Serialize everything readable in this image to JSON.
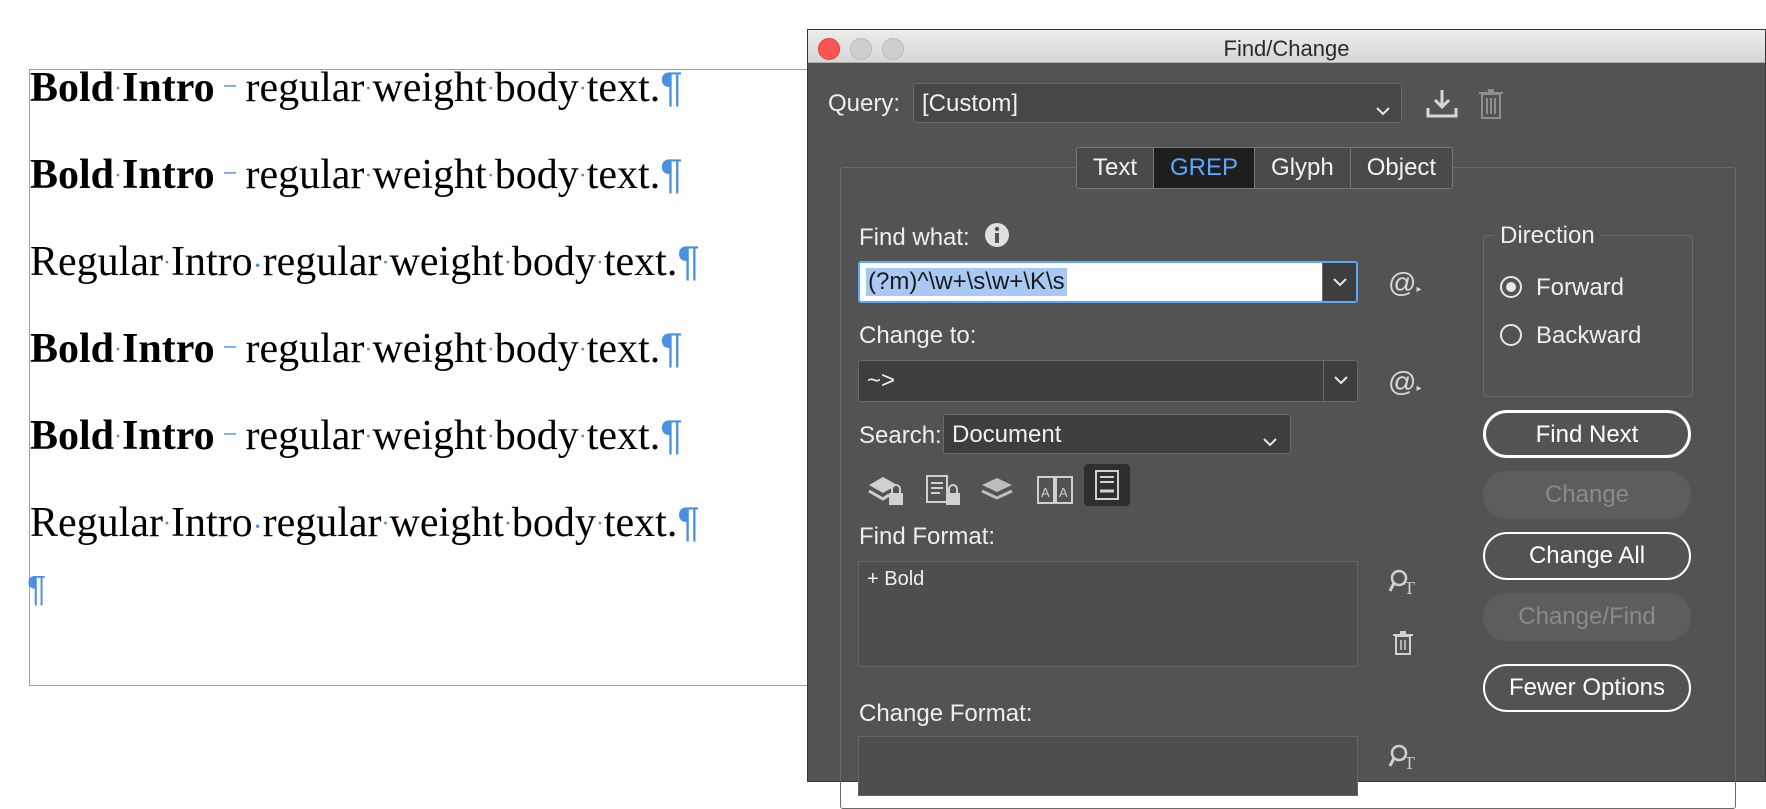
{
  "document": {
    "lines": [
      {
        "style": "bold",
        "w1": "Bold",
        "w2": "Intro",
        "rest": [
          "regular",
          "weight",
          "body",
          "text."
        ]
      },
      {
        "style": "bold",
        "w1": "Bold",
        "w2": "Intro",
        "rest": [
          "regular",
          "weight",
          "body",
          "text."
        ]
      },
      {
        "style": "regular",
        "w1": "Regular",
        "w2": "Intro",
        "rest": [
          "regular",
          "weight",
          "body",
          "text."
        ]
      },
      {
        "style": "bold",
        "w1": "Bold",
        "w2": "Intro",
        "rest": [
          "regular",
          "weight",
          "body",
          "text."
        ]
      },
      {
        "style": "bold",
        "w1": "Bold",
        "w2": "Intro",
        "rest": [
          "regular",
          "weight",
          "body",
          "text."
        ]
      },
      {
        "style": "regular",
        "w1": "Regular",
        "w2": "Intro",
        "rest": [
          "regular",
          "weight",
          "body",
          "text."
        ]
      }
    ],
    "pilcrow": "¶"
  },
  "dialog": {
    "title": "Find/Change",
    "query_label": "Query:",
    "query_value": "[Custom]",
    "tabs": [
      {
        "label": "Text",
        "active": false
      },
      {
        "label": "GREP",
        "active": true
      },
      {
        "label": "Glyph",
        "active": false
      },
      {
        "label": "Object",
        "active": false
      }
    ],
    "find_what_label": "Find what:",
    "find_what_value": "(?m)^\\w+\\s\\w+\\K\\s",
    "change_to_label": "Change to:",
    "change_to_value": "~>",
    "search_label": "Search:",
    "search_value": "Document",
    "find_format_label": "Find Format:",
    "find_format_value": "+ Bold",
    "change_format_label": "Change Format:",
    "direction": {
      "legend": "Direction",
      "forward": "Forward",
      "backward": "Backward",
      "selected": "forward"
    },
    "buttons": {
      "find_next": "Find Next",
      "change": "Change",
      "change_all": "Change All",
      "change_find": "Change/Find",
      "fewer_options": "Fewer Options"
    },
    "special_char_icon": "@"
  },
  "colors": {
    "accent": "#5aa8ff",
    "selection": "#a9c9f5",
    "dialog_bg": "#535353"
  }
}
